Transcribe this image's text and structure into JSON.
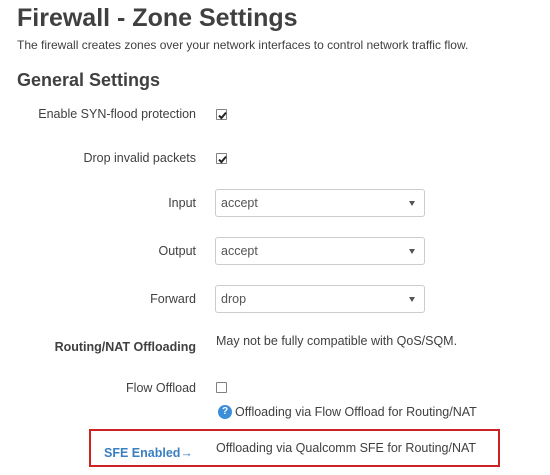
{
  "page": {
    "title": "Firewall - Zone Settings",
    "description": "The firewall creates zones over your network interfaces to control network traffic flow."
  },
  "general": {
    "section_title": "General Settings",
    "syn_flood": {
      "label": "Enable SYN-flood protection",
      "checked": true
    },
    "drop_invalid": {
      "label": "Drop invalid packets",
      "checked": true
    },
    "input": {
      "label": "Input",
      "value": "accept"
    },
    "output": {
      "label": "Output",
      "value": "accept"
    },
    "forward": {
      "label": "Forward",
      "value": "drop"
    }
  },
  "offloading": {
    "label": "Routing/NAT Offloading",
    "note": "May not be fully compatible with QoS/SQM.",
    "flow_offload": {
      "label": "Flow Offload",
      "checked": false,
      "help_text": "Offloading via Flow Offload for Routing/NAT"
    },
    "sfe": {
      "label": "SFE Enabled→",
      "note": "Offloading via Qualcomm SFE for Routing/NAT"
    }
  },
  "colors": {
    "text": "#404040",
    "link_blue": "#3a7fc1",
    "help_icon": "#3a8fd8",
    "highlight_border": "#cc2222"
  },
  "icons": {
    "help": "question-circle-icon",
    "select_caret": "chevron-down-icon",
    "checkmark": "checkmark-icon"
  }
}
